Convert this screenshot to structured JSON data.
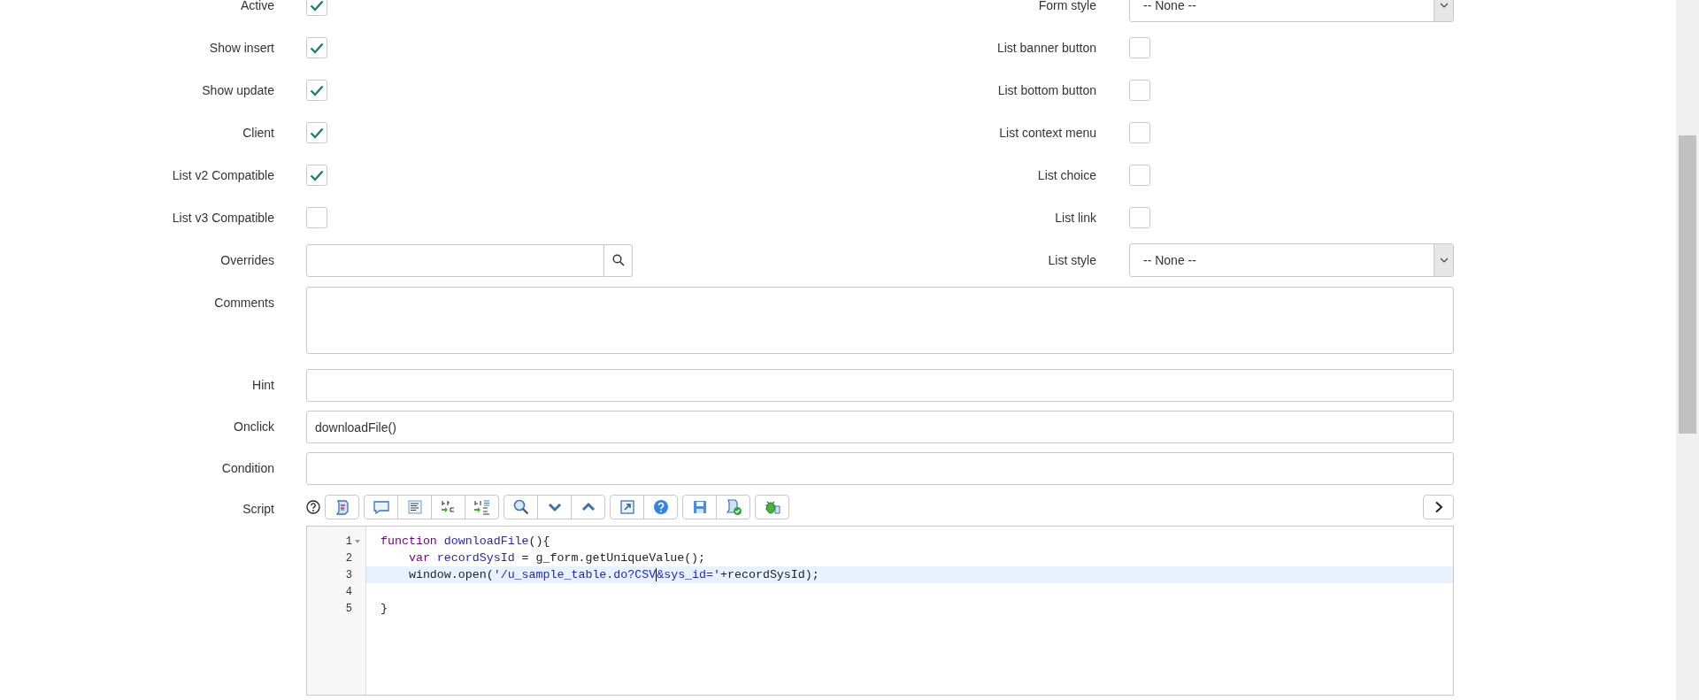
{
  "left_fields": [
    {
      "label": "Active",
      "kind": "checkbox",
      "checked": true
    },
    {
      "label": "Show insert",
      "kind": "checkbox",
      "checked": true
    },
    {
      "label": "Show update",
      "kind": "checkbox",
      "checked": true
    },
    {
      "label": "Client",
      "kind": "checkbox",
      "checked": true
    },
    {
      "label": "List v2 Compatible",
      "kind": "checkbox",
      "checked": true
    },
    {
      "label": "List v3 Compatible",
      "kind": "checkbox",
      "checked": false
    },
    {
      "label": "Overrides",
      "kind": "reference"
    }
  ],
  "right_fields": [
    {
      "label": "Form style",
      "kind": "select",
      "value": "-- None --"
    },
    {
      "label": "List banner button",
      "kind": "checkbox",
      "checked": false
    },
    {
      "label": "List bottom button",
      "kind": "checkbox",
      "checked": false
    },
    {
      "label": "List context menu",
      "kind": "checkbox",
      "checked": false
    },
    {
      "label": "List choice",
      "kind": "checkbox",
      "checked": false
    },
    {
      "label": "List link",
      "kind": "checkbox",
      "checked": false
    },
    {
      "label": "List style",
      "kind": "select",
      "value": "-- None --"
    }
  ],
  "wide_fields": [
    {
      "label": "Comments",
      "kind": "textarea"
    },
    {
      "label": "Hint",
      "kind": "text"
    },
    {
      "label": "Onclick",
      "kind": "text",
      "value": "downloadFile()"
    },
    {
      "label": "Condition",
      "kind": "text"
    }
  ],
  "script": {
    "label": "Script",
    "toolbar": [
      [
        {
          "kind": "script"
        }
      ],
      [
        {
          "kind": "comment"
        },
        {
          "kind": "format"
        },
        {
          "kind": "replace"
        },
        {
          "kind": "replaceall"
        }
      ],
      [
        {
          "kind": "search"
        },
        {
          "kind": "next"
        },
        {
          "kind": "previous"
        }
      ],
      [
        {
          "kind": "fullscreen"
        },
        {
          "kind": "help"
        }
      ],
      [
        {
          "kind": "save"
        },
        {
          "kind": "validate"
        }
      ],
      [
        {
          "kind": "debug"
        }
      ]
    ],
    "lines": [
      {
        "number": "1",
        "fold": true,
        "active": false,
        "tokens": [
          {
            "kind": "keyword",
            "text": "function"
          },
          {
            "kind": "def",
            "text": " downloadFile"
          },
          {
            "kind": "plain",
            "text": "(){"
          }
        ]
      },
      {
        "number": "2",
        "fold": false,
        "active": false,
        "tokens": [
          {
            "kind": "keyword",
            "text": "    var"
          },
          {
            "kind": "def",
            "text": " recordSysId"
          },
          {
            "kind": "plain",
            "text": " = g_form.getUniqueValue();"
          }
        ]
      },
      {
        "number": "3",
        "fold": false,
        "active": true,
        "tokens": [
          {
            "kind": "plain",
            "text": "    window.open("
          },
          {
            "kind": "string",
            "text": "'/u_sample_table.do?CSV"
          },
          {
            "kind": "cursor"
          },
          {
            "kind": "string",
            "text": "&sys_id='"
          },
          {
            "kind": "plain",
            "text": "+recordSysId);"
          }
        ]
      },
      {
        "number": "4",
        "fold": false,
        "active": false
      },
      {
        "number": "5",
        "fold": false,
        "active": false,
        "tokens": [
          {
            "kind": "plain",
            "text": "}"
          }
        ]
      }
    ]
  }
}
